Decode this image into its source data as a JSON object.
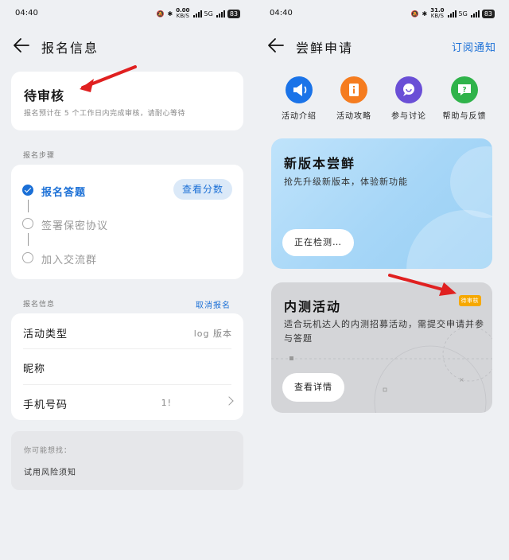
{
  "left": {
    "status_bar": {
      "time": "04:40",
      "net_speed": "0.00",
      "net_unit": "KB/S",
      "signal_tag": "5G",
      "battery": "83"
    },
    "nav_title": "报名信息",
    "review": {
      "title": "待审核",
      "subtitle": "报名预计在 5 个工作日内完成审核，请耐心等待"
    },
    "steps_label": "报名步骤",
    "steps": [
      {
        "label": "报名答题",
        "done": true
      },
      {
        "label": "签署保密协议",
        "done": false
      },
      {
        "label": "加入交流群",
        "done": false
      }
    ],
    "score_button": "查看分数",
    "info_label": "报名信息",
    "cancel_label": "取消报名",
    "info_rows": [
      {
        "key": "活动类型",
        "value": "log 版本"
      },
      {
        "key": "昵称",
        "value": ""
      },
      {
        "key": "手机号码",
        "value": "1!"
      }
    ],
    "maybe": {
      "title": "你可能想找：",
      "item": "试用风险须知"
    }
  },
  "right": {
    "status_bar": {
      "time": "04:40",
      "net_speed": "31.0",
      "net_unit": "KB/S",
      "signal_tag": "5G",
      "battery": "83"
    },
    "nav_title": "尝鲜申请",
    "nav_action": "订阅通知",
    "quick_actions": [
      {
        "label": "活动介绍",
        "icon": "megaphone-icon",
        "color": "#1a73e8"
      },
      {
        "label": "活动攻略",
        "icon": "guide-book-icon",
        "color": "#f57c1f"
      },
      {
        "label": "参与讨论",
        "icon": "chat-bubble-icon",
        "color": "#6a4fd6"
      },
      {
        "label": "帮助与反馈",
        "icon": "help-icon",
        "color": "#2fb34a"
      }
    ],
    "new_version": {
      "title": "新版本尝鲜",
      "subtitle": "抢先升级新版本，体验新功能",
      "button": "正在检测…"
    },
    "beta": {
      "title": "内测活动",
      "badge": "待审核",
      "subtitle": "适合玩机达人的内测招募活动，需提交申请并参与答题",
      "button": "查看详情"
    }
  },
  "colors": {
    "accent": "#1a6fd6",
    "badge": "#f6a800",
    "arrow": "#e02020"
  }
}
